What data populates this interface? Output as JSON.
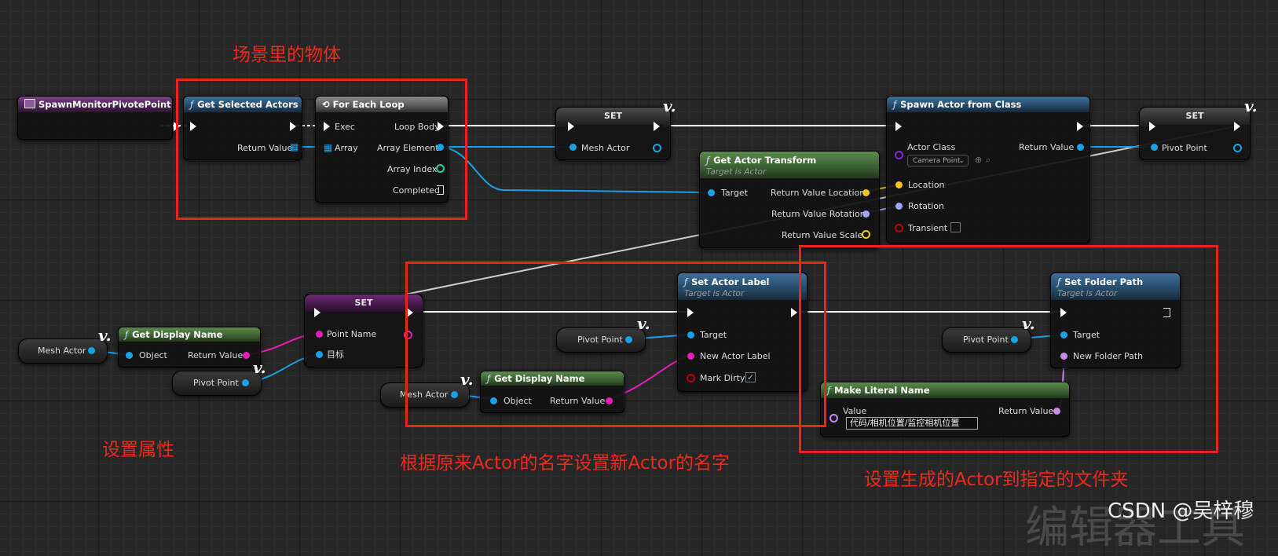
{
  "nodes": {
    "event": {
      "title": "SpawnMonitorPivotePoint"
    },
    "get_selected": {
      "title": "Get Selected Actors",
      "return_value": "Return Value"
    },
    "foreach": {
      "title": "For Each Loop",
      "exec": "Exec",
      "array": "Array",
      "loop_body": "Loop Body",
      "array_element": "Array Element",
      "array_index": "Array Index",
      "completed": "Completed"
    },
    "set_mesh": {
      "title": "SET",
      "mesh_actor": "Mesh Actor"
    },
    "get_transform": {
      "title": "Get Actor Transform",
      "subtitle": "Target is Actor",
      "target": "Target",
      "ret_location": "Return Value Location",
      "ret_rotation": "Return Value Rotation",
      "ret_scale": "Return Value Scale"
    },
    "spawn": {
      "title": "Spawn Actor from Class",
      "actor_class": "Actor Class",
      "class_value": "Camera Point",
      "return_value": "Return Value",
      "location": "Location",
      "rotation": "Rotation",
      "transient": "Transient"
    },
    "set_pivot": {
      "title": "SET",
      "pivot_point": "Pivot Point"
    },
    "getter_mesh1": {
      "label": "Mesh Actor"
    },
    "get_display1": {
      "title": "Get Display Name",
      "object": "Object",
      "return_value": "Return Value"
    },
    "getter_pivot1": {
      "label": "Pivot Point"
    },
    "set_point_name": {
      "title": "SET",
      "point_name": "Point Name",
      "target": "目标"
    },
    "getter_pivot2": {
      "label": "Pivot Point"
    },
    "getter_mesh2": {
      "label": "Mesh Actor"
    },
    "get_display2": {
      "title": "Get Display Name",
      "object": "Object",
      "return_value": "Return Value"
    },
    "set_label": {
      "title": "Set Actor Label",
      "subtitle": "Target is Actor",
      "target": "Target",
      "new_label": "New Actor Label",
      "mark_dirty": "Mark Dirty"
    },
    "make_literal": {
      "title": "Make Literal Name",
      "value": "Value",
      "return_value": "Return Value",
      "text_value": "代码/相机位置/监控相机位置"
    },
    "getter_pivot3": {
      "label": "Pivot Point"
    },
    "set_folder": {
      "title": "Set Folder Path",
      "subtitle": "Target is Actor",
      "target": "Target",
      "new_folder": "New Folder Path"
    }
  },
  "annotations": {
    "scene_objects": "场景里的物体",
    "set_props": "设置属性",
    "name_by_orig": "根据原来Actor的名字设置新Actor的名字",
    "folder": "设置生成的Actor到指定的文件夹"
  },
  "watermark": {
    "csdn": "CSDN @吴梓穆",
    "editor": "编辑器工具"
  },
  "colors": {
    "object_pin": "#19a1e6",
    "string_pin": "#e81db7",
    "vector_pin": "#f5c518",
    "rotator_pin": "#9aa8f5",
    "name_pin": "#c98af0",
    "int_pin": "#1fd39a",
    "class_pin": "#7a2bd6",
    "annotation_red": "#e8241c"
  }
}
